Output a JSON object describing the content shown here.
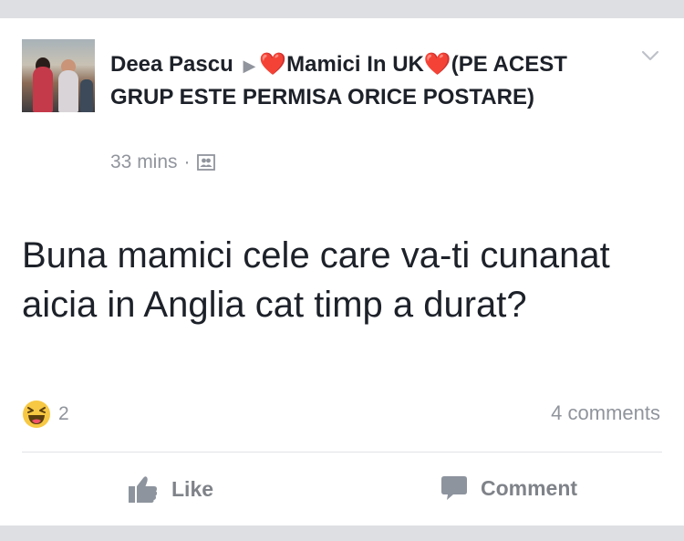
{
  "post": {
    "author": "Deea Pascu",
    "group_separator": "▶",
    "heart": "❤️",
    "group_name": "Mamici In UK",
    "group_suffix": "(PE ACEST GRUP ESTE PERMISA ORICE POSTARE)",
    "time": "33 mins",
    "meta_separator": "·",
    "audience_icon": "group-audience-icon",
    "text": "Buna mamici cele care va-ti cunanat aicia in Anglia  cat  timp a durat?",
    "reaction_icon": "haha-icon",
    "reaction_count": "2",
    "comments": "4 comments"
  },
  "actions": {
    "like_label": "Like",
    "comment_label": "Comment"
  },
  "colors": {
    "background": "#dddfe2",
    "card": "#ffffff",
    "text": "#1d2129",
    "secondary_text": "#90949c",
    "action_text": "#7f8389",
    "heart": "#e0243a",
    "haha_face": "#f7c843"
  }
}
